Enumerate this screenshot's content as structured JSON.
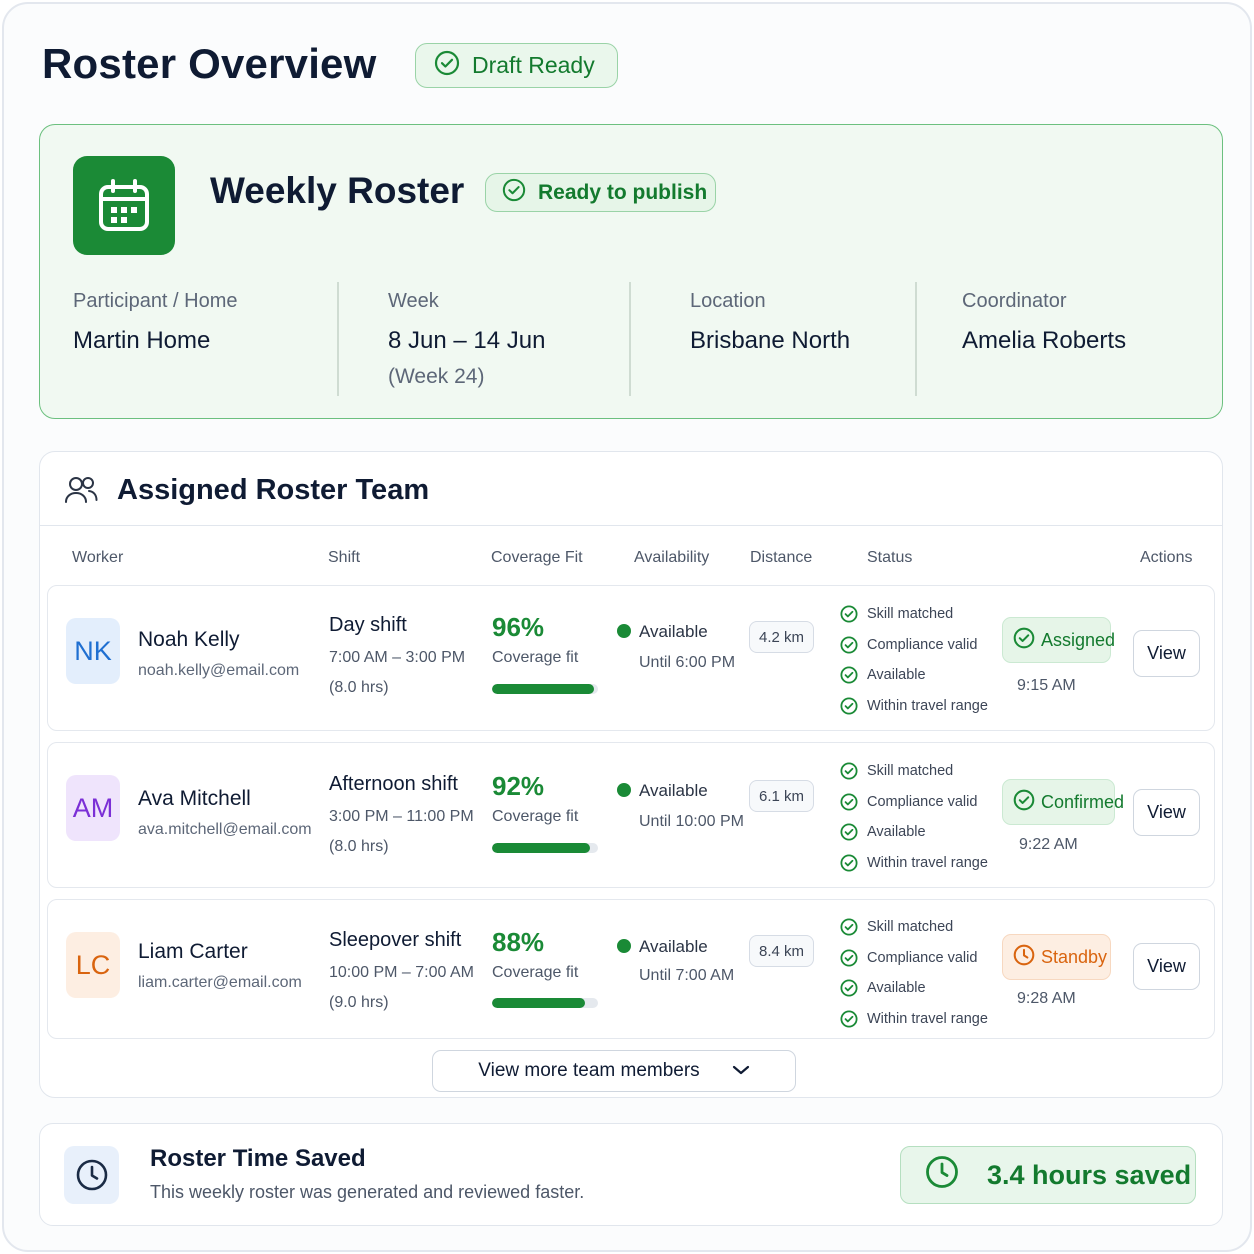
{
  "header": {
    "title": "Roster Overview",
    "draft_badge": "Draft Ready"
  },
  "roster_card": {
    "title": "Weekly Roster",
    "publish_badge": "Ready to publish",
    "participant": {
      "label": "Participant / Home",
      "value": "Martin Home"
    },
    "week": {
      "label": "Week",
      "value": "8 Jun – 14 Jun",
      "sub": "(Week 24)"
    },
    "location": {
      "label": "Location",
      "value": "Brisbane North"
    },
    "coordinator": {
      "label": "Coordinator",
      "value": "Amelia Roberts"
    }
  },
  "team": {
    "title": "Assigned Roster Team",
    "columns": [
      "Worker",
      "Shift",
      "Coverage Fit",
      "Availability",
      "Distance",
      "Status",
      "Actions"
    ],
    "rows": [
      {
        "initials": "NK",
        "name": "Noah Kelly",
        "email": "noah.kelly@email.com",
        "shift": "Day shift",
        "shift_time": "7:00 AM – 3:00 PM",
        "shift_hours": "(8.0 hrs)",
        "fit": "96%",
        "fit_value": 0.96,
        "fit_label": "Coverage fit",
        "availability": "Available",
        "until": "Until 6:00 PM",
        "distance": "4.2 km",
        "checks": [
          "Skill matched",
          "Compliance valid",
          "Available",
          "Within travel range"
        ],
        "status": "Assigned",
        "status_time": "9:15 AM",
        "action": "View"
      },
      {
        "initials": "AM",
        "name": "Ava Mitchell",
        "email": "ava.mitchell@email.com",
        "shift": "Afternoon shift",
        "shift_time": "3:00 PM – 11:00 PM",
        "shift_hours": "(8.0 hrs)",
        "fit": "92%",
        "fit_value": 0.92,
        "fit_label": "Coverage fit",
        "availability": "Available",
        "until": "Until 10:00 PM",
        "distance": "6.1 km",
        "checks": [
          "Skill matched",
          "Compliance valid",
          "Available",
          "Within travel range"
        ],
        "status": "Confirmed",
        "status_time": "9:22 AM",
        "action": "View"
      },
      {
        "initials": "LC",
        "name": "Liam Carter",
        "email": "liam.carter@email.com",
        "shift": "Sleepover shift",
        "shift_time": "10:00 PM – 7:00 AM",
        "shift_hours": "(9.0 hrs)",
        "fit": "88%",
        "fit_value": 0.88,
        "fit_label": "Coverage fit",
        "availability": "Available",
        "until": "Until 7:00 AM",
        "distance": "8.4 km",
        "checks": [
          "Skill matched",
          "Compliance valid",
          "Available",
          "Within travel range"
        ],
        "status": "Standby",
        "status_time": "9:28 AM",
        "action": "View"
      }
    ],
    "more_button": "View more team members"
  },
  "time_saved": {
    "title": "Roster Time Saved",
    "description": "This weekly roster was generated and reviewed faster.",
    "value": "3.4 hours saved"
  },
  "colors": {
    "accent_green": "#1a8a36",
    "standby_orange": "#d9640f",
    "avatar_nk": "#1f6fd1",
    "avatar_am": "#7b2fd6",
    "avatar_lc": "#d9640f"
  },
  "icons": {
    "draft_badge": "check-circle-icon",
    "calendar_tile": "calendar-icon",
    "team": "users-icon",
    "check_items": "check-circle-icon",
    "more_button": "chevron-down-icon",
    "time_saved": "clock-icon"
  }
}
